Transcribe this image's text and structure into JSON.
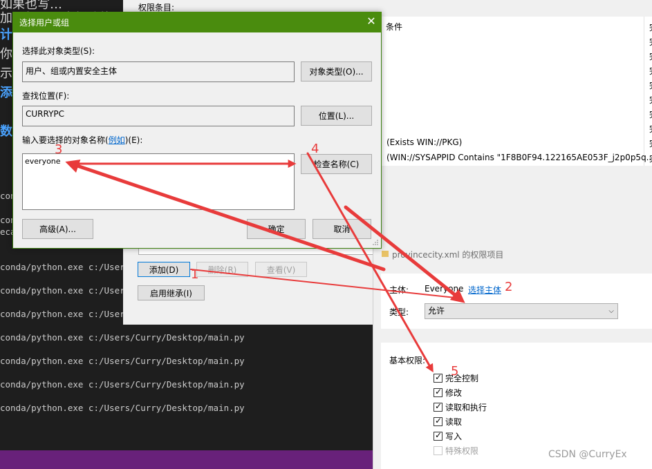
{
  "terminal": {
    "blog_fragments": [
      "如果也写…",
      "加了如下几点新功能",
      "计",
      "你…",
      "示",
      "添加",
      "数"
    ],
    "lines": [
      "conda",
      "conda",
      "ecai",
      "conda/python.exe c:/Users/",
      "conda/python.exe c:/Users/",
      "conda/python.exe c:/Users/",
      "conda/python.exe c:/Users/Curry/Desktop/main.py",
      "conda/python.exe c:/Users/Curry/Desktop/main.py",
      "conda/python.exe c:/Users/Curry/Desktop/main.py",
      "conda/python.exe c:/Users/Curry/Desktop/main.py"
    ]
  },
  "permission_window": {
    "entries_label": "权限条目:",
    "condition_header": "条件",
    "conditions": [
      "(Exists WIN://PKG)",
      "(WIN://SYSAPPID Contains \"1F8B0F94.122165AE053F_j2p0p5q..."
    ],
    "right_column_marks": [
      "完",
      "完",
      "完",
      "完",
      "完",
      "完",
      "完",
      "完",
      "完",
      "完"
    ],
    "add_button": "添加(D)",
    "remove_button": "删除(R)",
    "view_button": "查看(V)",
    "inherit_button": "启用继承(I)"
  },
  "entry_window": {
    "title": "provincecity.xml 的权限项目",
    "principal_label": "主体:",
    "principal_value": "Everyone",
    "select_principal_link": "选择主体",
    "type_label": "类型:",
    "type_value": "允许",
    "basic_permissions_label": "基本权限:",
    "permissions": [
      {
        "label": "完全控制",
        "checked": true,
        "disabled": false
      },
      {
        "label": "修改",
        "checked": true,
        "disabled": false
      },
      {
        "label": "读取和执行",
        "checked": true,
        "disabled": false
      },
      {
        "label": "读取",
        "checked": true,
        "disabled": false
      },
      {
        "label": "写入",
        "checked": true,
        "disabled": false
      },
      {
        "label": "特殊权限",
        "checked": false,
        "disabled": true
      }
    ]
  },
  "dialog": {
    "title": "选择用户或组",
    "object_type_label": "选择此对象类型(S):",
    "object_type_value": "用户、组或内置安全主体",
    "object_types_button": "对象类型(O)...",
    "location_label": "查找位置(F):",
    "location_value": "CURRYPC",
    "locations_button": "位置(L)...",
    "names_label_prefix": "输入要选择的对象名称(",
    "names_label_link": "例如",
    "names_label_suffix": ")(E):",
    "names_value": "everyone",
    "check_names_button": "检查名称(C)",
    "advanced_button": "高级(A)...",
    "ok_button": "确定",
    "cancel_button": "取消"
  },
  "annotations": {
    "step_numbers": [
      "1",
      "2",
      "3",
      "4",
      "5"
    ],
    "arrow_color": "#e83b3b"
  },
  "watermark": "CSDN @CurryEx"
}
